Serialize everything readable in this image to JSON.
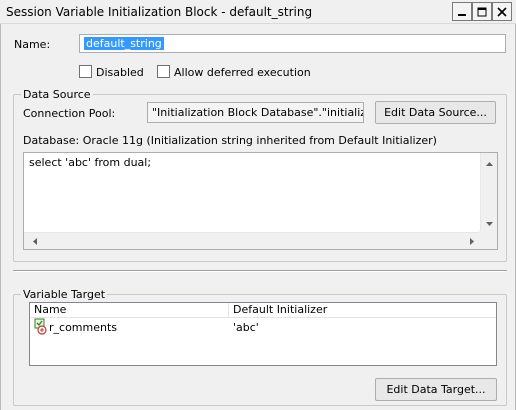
{
  "window": {
    "title": "Session Variable Initialization Block - default_string"
  },
  "form": {
    "name_label": "Name:",
    "name_value": "default_string",
    "disabled_label": "Disabled",
    "disabled_checked": false,
    "deferred_label": "Allow deferred execution",
    "deferred_checked": false
  },
  "data_source": {
    "group_title": "Data Source",
    "connection_pool_label": "Connection Pool:",
    "connection_pool_value": "\"Initialization Block Database\".\"initialization b",
    "edit_button": "Edit Data Source...",
    "database_info": "Database: Oracle 11g (Initialization string inherited from Default Initializer)",
    "sql_text": "select 'abc' from dual;"
  },
  "variable_target": {
    "group_title": "Variable Target",
    "columns": [
      "Name",
      "Default Initializer"
    ],
    "rows": [
      {
        "name": "r_comments",
        "default_initializer": "'abc'",
        "icon": "session-variable-icon"
      }
    ],
    "edit_button": "Edit Data Target..."
  }
}
